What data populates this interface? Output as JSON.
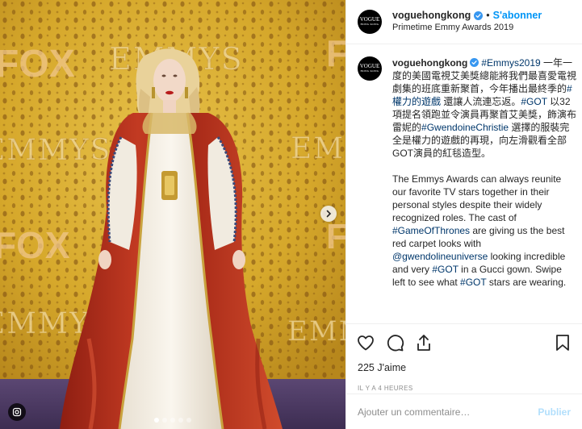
{
  "colors": {
    "accent": "#0095f6",
    "link": "#00376b",
    "muted": "#8e8e8e",
    "background_gold": "#d4a52a",
    "gown_red": "#b8311f",
    "gown_white": "#f4efe6"
  },
  "photo": {
    "icons": {
      "next": "chevron-right-icon",
      "badge": "instagram-glyph-icon"
    },
    "slides": 5,
    "active_slide": 1
  },
  "post": {
    "avatar_text": "VOGUE",
    "avatar_sub": "HONG KONG",
    "username": "voguehongkong",
    "separator": "•",
    "follow_label": "S'abonner",
    "location": "Primetime Emmy Awards 2019"
  },
  "caption": {
    "username": "voguehongkong",
    "hashtag_emmys": "#Emmys2019",
    "zh_part1": " 一年一度的美國電視艾美獎總能將我們最喜愛電視劇集的班底重新聚首，今年播出最終季的",
    "hashtag_power": "#權力的遊戲",
    "zh_part2": " 還讓人流連忘返。",
    "hashtag_got": "#GOT",
    "zh_part3": " 以32項提名領跑並令演員再聚首艾美獎，飾演布雷妮的",
    "hashtag_gwen": "#GwendoineChristie",
    "zh_part4": " 選擇的服裝完全是權力的遊戲的再現，向左滑觀看全部GOT演員的紅毯造型。",
    "en_part1": "The Emmys Awards can always reunite our favorite TV stars together in their personal styles despite their widely recognized roles. The cast of ",
    "hashtag_got_full": "#GameOfThrones",
    "en_part2": " are giving us the best red carpet looks with ",
    "mention": "@gwendolineuniverse",
    "en_part3": " looking incredible and very ",
    "hashtag_got2": "#GOT",
    "en_part4": " in a Gucci gown. Swipe left to see what ",
    "hashtag_got3": "#GOT",
    "en_part5": " stars are wearing."
  },
  "actions": {
    "like_icon": "heart-icon",
    "comment_icon": "comment-icon",
    "share_icon": "share-icon",
    "save_icon": "bookmark-icon",
    "likes_text": "225 J'aime",
    "timestamp": "IL Y A 4 HEURES"
  },
  "comment": {
    "placeholder": "Ajouter un commentaire…",
    "post_label": "Publier"
  }
}
